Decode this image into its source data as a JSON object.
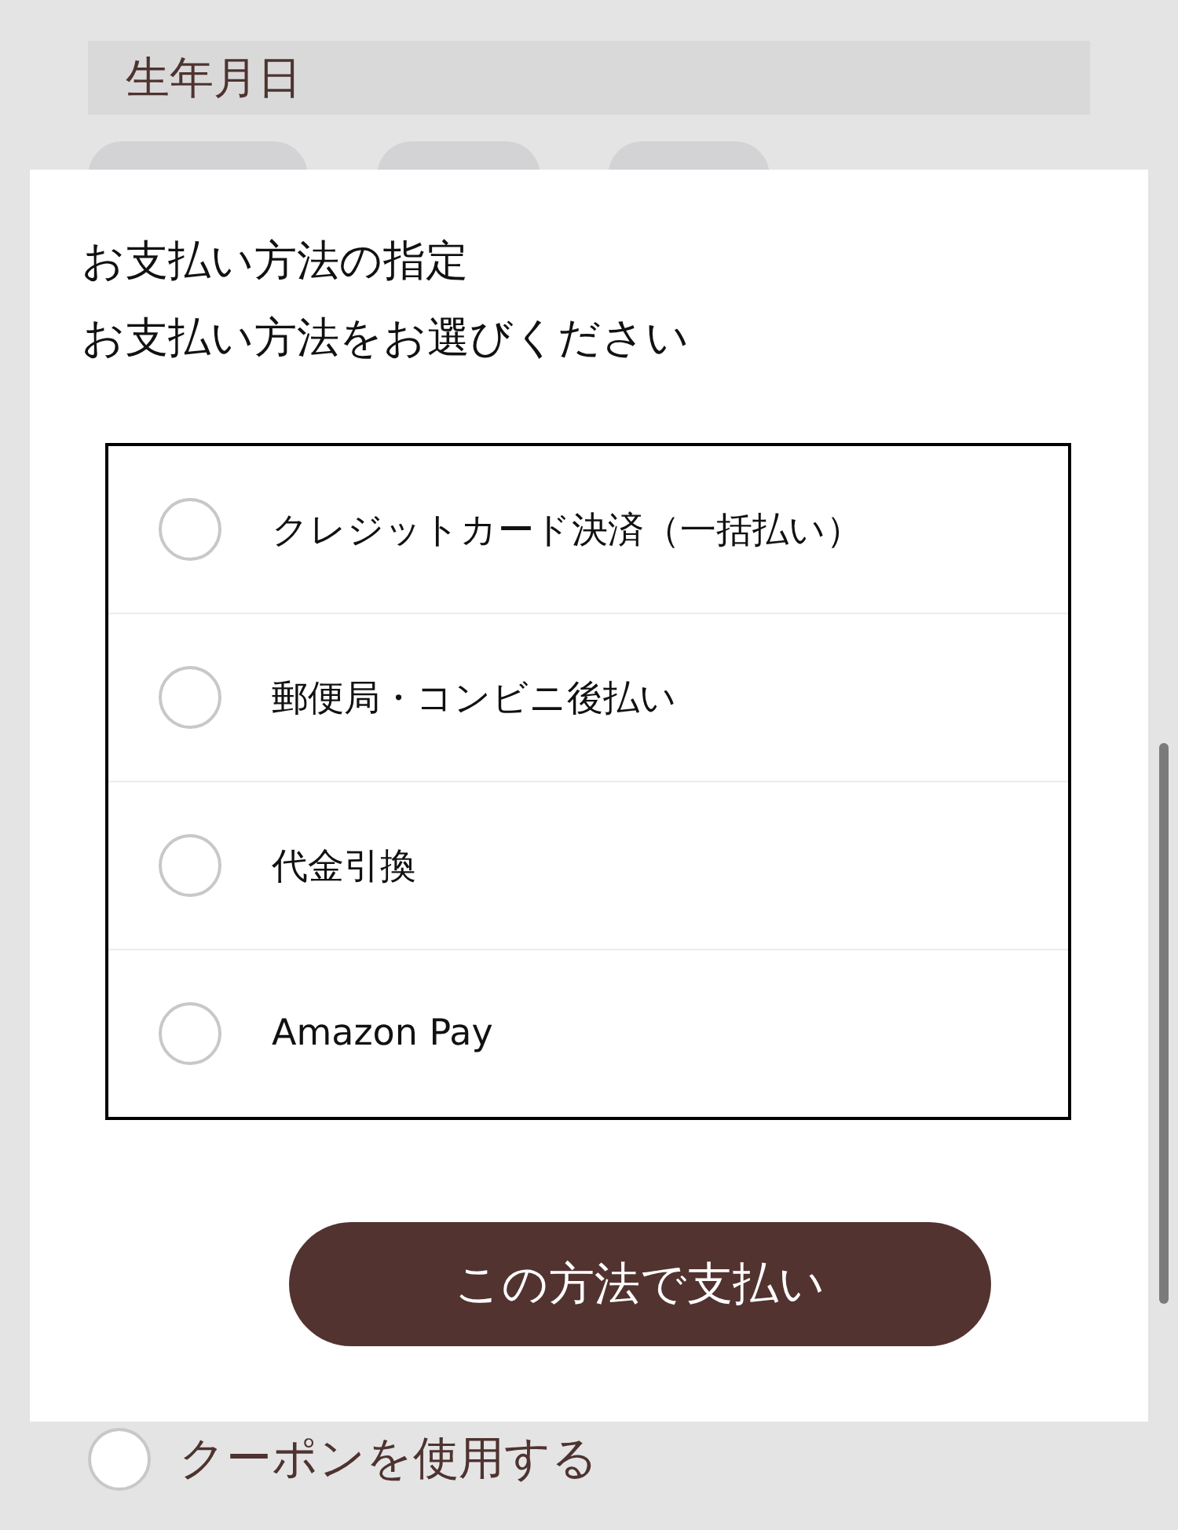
{
  "form": {
    "birthdate_label": "生年月日",
    "coupon": {
      "label": "クーポンを使用する",
      "checked": false
    }
  },
  "dialog": {
    "title": "お支払い方法の指定",
    "subtitle": "お支払い方法をお選びください",
    "options": [
      {
        "label": "クレジットカード決済（一括払い）",
        "selected": false
      },
      {
        "label": "郵便局・コンビニ後払い",
        "selected": false
      },
      {
        "label": "代金引換",
        "selected": false
      },
      {
        "label": "Amazon Pay",
        "selected": false
      }
    ],
    "confirm_button": "この方法で支払い"
  }
}
